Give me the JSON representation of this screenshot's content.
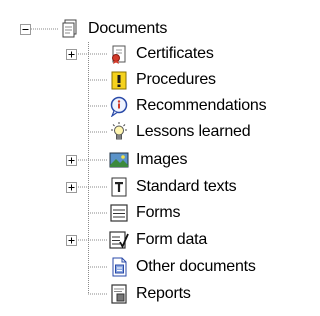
{
  "tree": {
    "root": {
      "label": "Documents",
      "icon": "document-folder-icon",
      "expanded": true
    },
    "children": [
      {
        "label": "Certificates",
        "icon": "certificate-icon",
        "expandable": true
      },
      {
        "label": "Procedures",
        "icon": "warning-note-icon",
        "expandable": false
      },
      {
        "label": "Recommendations",
        "icon": "recommendation-icon",
        "expandable": false
      },
      {
        "label": "Lessons learned",
        "icon": "lightbulb-icon",
        "expandable": false
      },
      {
        "label": "Images",
        "icon": "image-icon",
        "expandable": true
      },
      {
        "label": "Standard texts",
        "icon": "text-document-icon",
        "expandable": true
      },
      {
        "label": "Forms",
        "icon": "form-icon",
        "expandable": false
      },
      {
        "label": "Form data",
        "icon": "form-data-icon",
        "expandable": true
      },
      {
        "label": "Other documents",
        "icon": "other-document-icon",
        "expandable": false
      },
      {
        "label": "Reports",
        "icon": "report-icon",
        "expandable": false
      }
    ]
  }
}
